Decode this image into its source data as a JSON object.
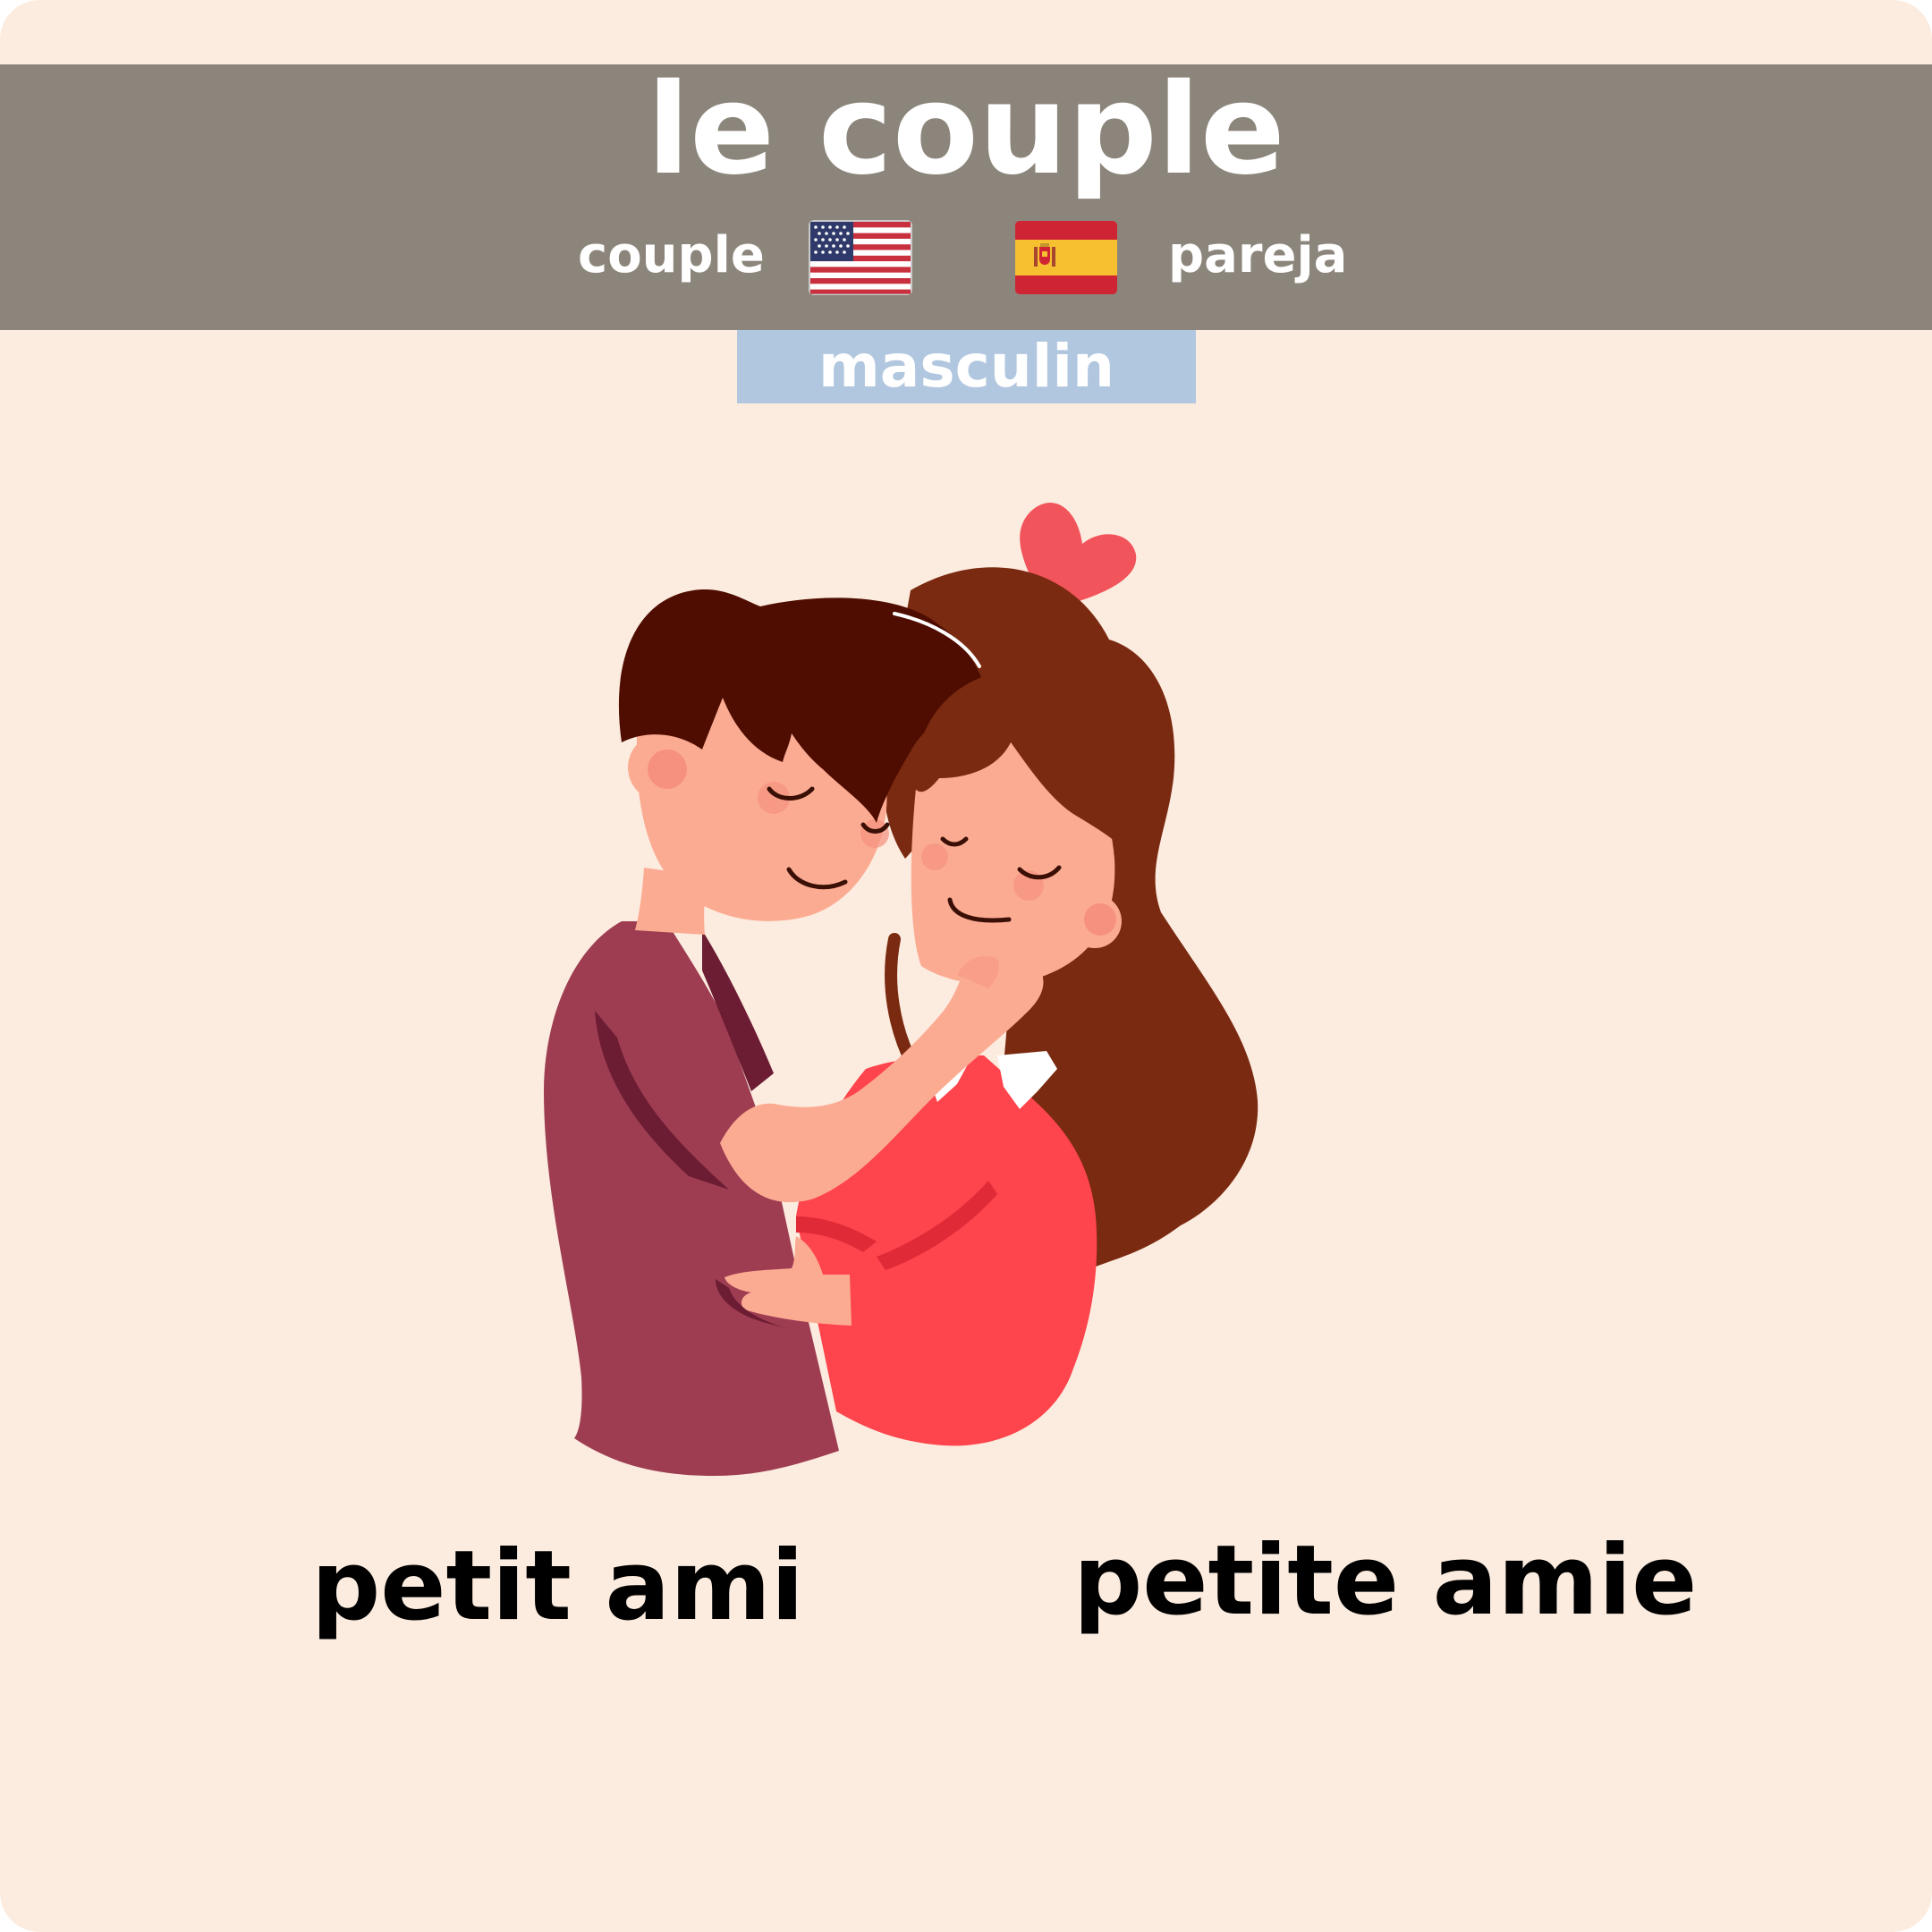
{
  "card": {
    "title": "le couple",
    "translations": {
      "english": {
        "text": "couple",
        "flag": "us-flag-icon"
      },
      "spanish": {
        "text": "pareja",
        "flag": "spain-flag-icon"
      }
    },
    "gender": "masculin",
    "illustration": "couple-embracing-with-heart",
    "labels": {
      "left": "petit ami",
      "right": "petite amie"
    }
  },
  "colors": {
    "background": "#fcecdf",
    "header": "#8c857b",
    "gender_badge": "#b1c7df",
    "heart": "#f2545b"
  }
}
